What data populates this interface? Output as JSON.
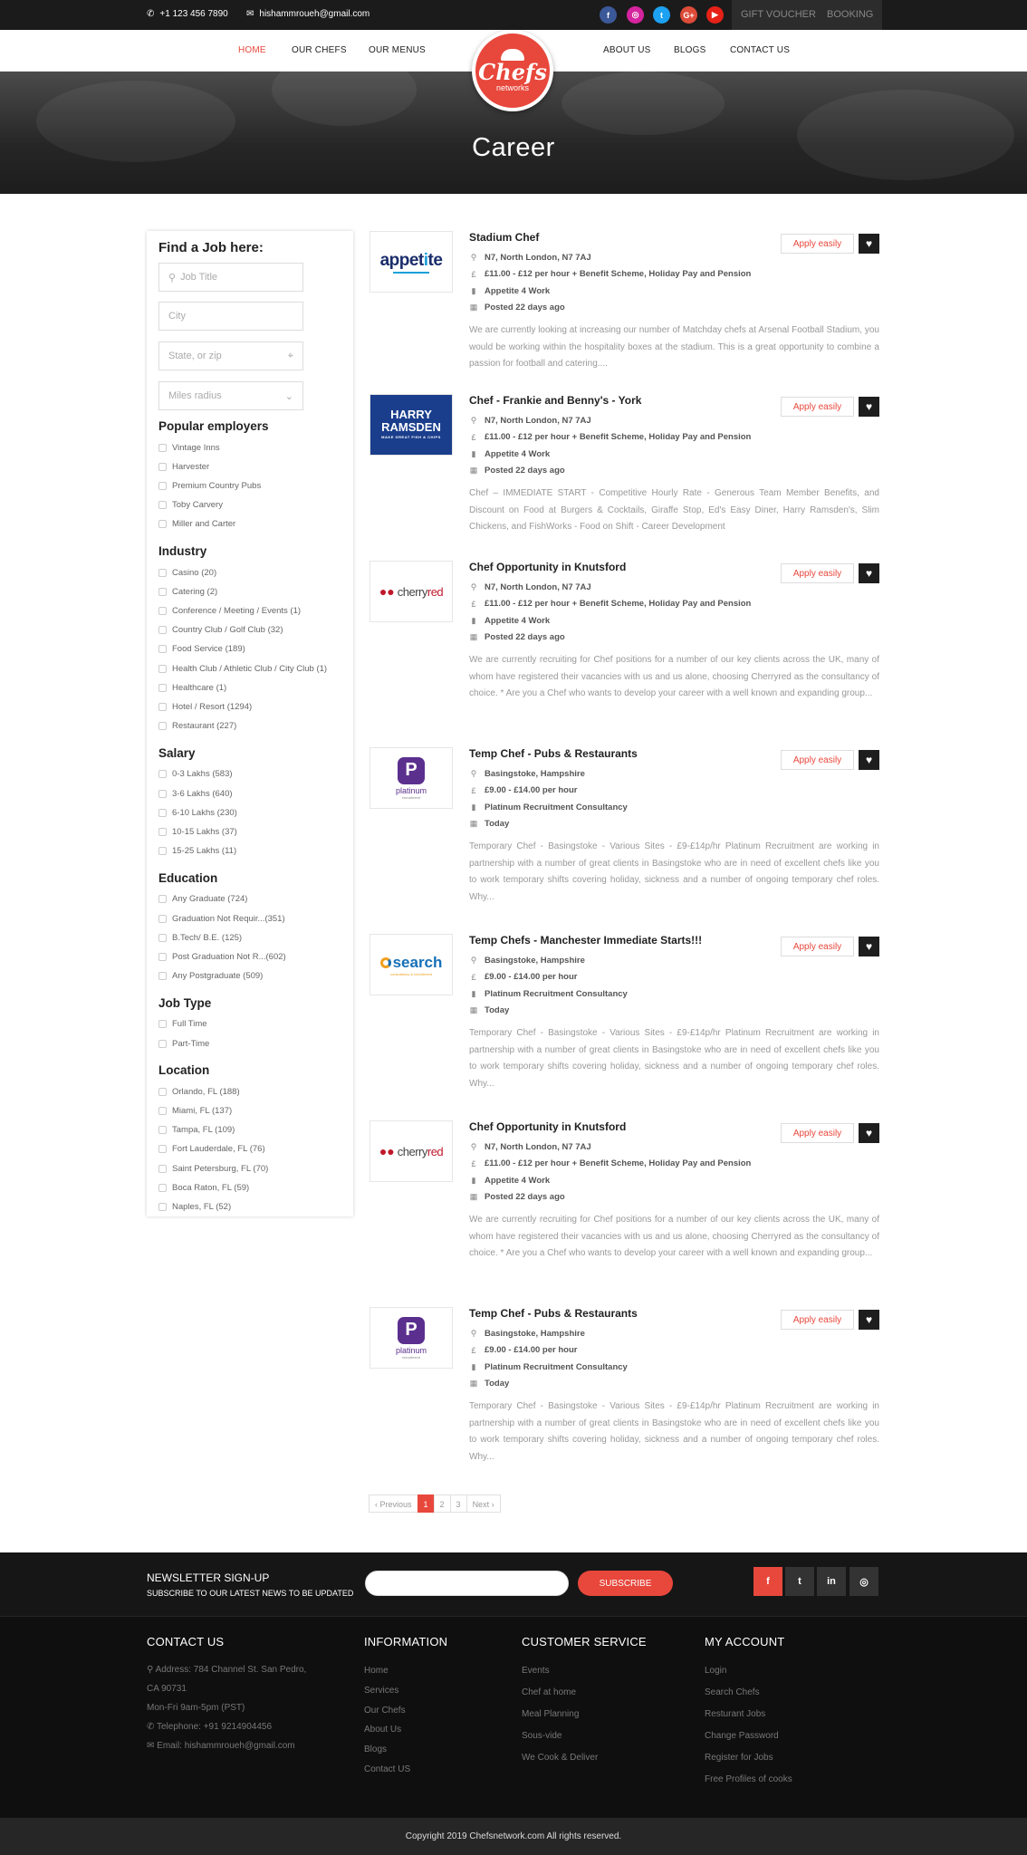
{
  "topbar": {
    "phone": "+1 123 456 7890",
    "email": "hishammroueh@gmail.com",
    "social": [
      {
        "icon": "facebook-icon",
        "glyph": "f",
        "color": "#3b5998"
      },
      {
        "icon": "instagram-icon",
        "glyph": "◎",
        "color": "#d6249f"
      },
      {
        "icon": "twitter-icon",
        "glyph": "t",
        "color": "#1da1f2"
      },
      {
        "icon": "google-plus-icon",
        "glyph": "G+",
        "color": "#dd4b39"
      },
      {
        "icon": "youtube-icon",
        "glyph": "▶",
        "color": "#e62117"
      }
    ],
    "gift_voucher": "GIFT VOUCHER",
    "booking": "BOOKING"
  },
  "nav": {
    "home": "HOME",
    "our_chefs": "OUR CHEFS",
    "our_menus": "OUR MENUS",
    "about_us": "ABOUT US",
    "blogs": "BLOGS",
    "contact_us": "CONTACT US",
    "logo_line1": "Chefs",
    "logo_line2": "networks",
    "accent": "#e8473c"
  },
  "hero": {
    "title": "Career"
  },
  "filter": {
    "title": "Find a Job here:",
    "job_title_placeholder": "Job Title",
    "city_placeholder": "City",
    "state_placeholder": "State, or zip",
    "radius_placeholder": "Miles radius",
    "sections": [
      {
        "title": "Popular employers",
        "options": [
          "Vintage Inns",
          "Harvester",
          "Premium Country Pubs",
          "Toby Carvery",
          "Miller and Carter"
        ]
      },
      {
        "title": "Industry",
        "options": [
          "Casino (20)",
          "Catering (2)",
          "Conference / Meeting / Events (1)",
          "Country Club / Golf Club (32)",
          "Food Service (189)",
          "Health Club / Athletic Club / City Club (1)",
          "Healthcare (1)",
          "Hotel / Resort (1294)",
          "Restaurant (227)"
        ]
      },
      {
        "title": "Salary",
        "options": [
          "0-3 Lakhs (583)",
          "3-6 Lakhs (640)",
          "6-10 Lakhs (230)",
          "10-15 Lakhs (37)",
          "15-25 Lakhs (11)"
        ]
      },
      {
        "title": "Education",
        "options": [
          "Any Graduate (724)",
          "Graduation Not Requir...(351)",
          "B.Tech/ B.E. (125)",
          "Post Graduation Not R...(602)",
          "Any Postgraduate (509)"
        ]
      },
      {
        "title": "Job Type",
        "options": [
          "Full Time",
          "Part-Time"
        ]
      },
      {
        "title": "Location",
        "options": [
          "Orlando, FL (188)",
          "Miami, FL (137)",
          "Tampa, FL (109)",
          "Fort Lauderdale, FL (76)",
          "Saint Petersburg, FL (70)",
          "Boca Raton, FL (59)",
          "Naples, FL (52)"
        ]
      }
    ]
  },
  "jobs": [
    {
      "logo": "appetite",
      "logo_text": "appetite",
      "title": "Stadium Chef",
      "location": "N7, North London, N7 7AJ",
      "salary": "£11.00 - £12 per hour + Benefit Scheme, Holiday Pay and Pension",
      "company": "Appetite 4 Work",
      "posted": "Posted 22 days ago",
      "desc": "We are currently looking at increasing our number of Matchday chefs at Arsenal Football Stadium, you would be working within the hospitality boxes at the stadium. This is a great opportunity to combine a passion for football and catering....",
      "apply": "Apply easily"
    },
    {
      "logo": "harry",
      "logo_text": "HARRY RAMSDEN",
      "title": "Chef - Frankie and Benny's - York",
      "location": "N7, North London, N7 7AJ",
      "salary": "£11.00 - £12 per hour + Benefit Scheme, Holiday Pay and Pension",
      "company": "Appetite 4 Work",
      "posted": "Posted 22 days ago",
      "desc": "Chef – IMMEDIATE START - Competitive Hourly Rate - Generous Team Member Benefits, and Discount on Food at Burgers & Cocktails, Giraffe Stop, Ed's Easy Diner, Harry Ramsden's, Slim Chickens, and FishWorks - Food on Shift - Career Development",
      "apply": "Apply easily"
    },
    {
      "logo": "cherry",
      "logo_text": "cherryred",
      "title": "Chef Opportunity in Knutsford",
      "location": "N7, North London, N7 7AJ",
      "salary": "£11.00 - £12 per hour + Benefit Scheme, Holiday Pay and Pension",
      "company": "Appetite 4 Work",
      "posted": "Posted 22 days ago",
      "desc": "We are currently recruiting for Chef positions for a number of our key clients across the UK, many of whom have registered their vacancies with us and us alone, choosing Cherryred as the consultancy of choice. * Are you a Chef who wants to develop your career with a well known and expanding group...",
      "apply": "Apply easily"
    },
    {
      "logo": "platinum",
      "logo_text": "platinum",
      "title": "Temp Chef - Pubs & Restaurants",
      "location": "Basingstoke, Hampshire",
      "salary": "£9.00 - £14.00 per hour",
      "company": "Platinum Recruitment Consultancy",
      "posted": "Today",
      "desc": "Temporary Chef - Basingstoke - Various Sites - £9-£14p/hr Platinum Recruitment are working in partnership with a number of great clients in Basingstoke who are in need of excellent chefs like you to work temporary shifts covering holiday, sickness and a number of ongoing temporary chef roles. Why...",
      "apply": "Apply easily"
    },
    {
      "logo": "search",
      "logo_text": "search",
      "title": "Temp Chefs - Manchester Immediate Starts!!!",
      "location": "Basingstoke, Hampshire",
      "salary": "£9.00 - £14.00 per hour",
      "company": "Platinum Recruitment Consultancy",
      "posted": "Today",
      "desc": "Temporary Chef - Basingstoke - Various Sites - £9-£14p/hr Platinum Recruitment are working in partnership with a number of great clients in Basingstoke who are in need of excellent chefs like you to work temporary shifts covering holiday, sickness and a number of ongoing temporary chef roles. Why...",
      "apply": "Apply easily"
    },
    {
      "logo": "cherry",
      "logo_text": "cherryred",
      "title": "Chef Opportunity in Knutsford",
      "location": "N7, North London, N7 7AJ",
      "salary": "£11.00 - £12 per hour + Benefit Scheme, Holiday Pay and Pension",
      "company": "Appetite 4 Work",
      "posted": "Posted 22 days ago",
      "desc": "We are currently recruiting for Chef positions for a number of our key clients across the UK, many of whom have registered their vacancies with us and us alone, choosing Cherryred as the consultancy of choice. * Are you a Chef who wants to develop your career with a well known and expanding group...",
      "apply": "Apply easily"
    },
    {
      "logo": "platinum",
      "logo_text": "platinum",
      "title": "Temp Chef - Pubs & Restaurants",
      "location": "Basingstoke, Hampshire",
      "salary": "£9.00 - £14.00 per hour",
      "company": "Platinum Recruitment Consultancy",
      "posted": "Today",
      "desc": "Temporary Chef - Basingstoke - Various Sites - £9-£14p/hr Platinum Recruitment are working in partnership with a number of great clients in Basingstoke who are in need of excellent chefs like you to work temporary shifts covering holiday, sickness and a number of ongoing temporary chef roles. Why...",
      "apply": "Apply easily"
    }
  ],
  "pagination": {
    "prev": "‹ Previous",
    "pages": [
      "1",
      "2",
      "3"
    ],
    "current": "1",
    "next": "Next ›"
  },
  "newsletter": {
    "title": "NEWSLETTER SIGN-UP",
    "subtitle": "SUBSCRIBE TO OUR LATEST NEWS TO BE UPDATED",
    "input_value": "",
    "button": "SUBSCRIBE",
    "social": [
      {
        "icon": "facebook-icon",
        "glyph": "f",
        "color": "#e8473c"
      },
      {
        "icon": "twitter-icon",
        "glyph": "t",
        "color": "#333333"
      },
      {
        "icon": "linkedin-icon",
        "glyph": "in",
        "color": "#333333"
      },
      {
        "icon": "instagram-icon",
        "glyph": "◎",
        "color": "#333333"
      }
    ]
  },
  "footer": {
    "contact": {
      "title": "CONTACT US",
      "address": "Address: 784 Channel St. San Pedro,",
      "address2": "CA 90731",
      "hours": "Mon-Fri 9am-5pm (PST)",
      "telephone": "Telephone: +91 9214904456",
      "email": "Email: hishammroueh@gmail.com"
    },
    "information": {
      "title": "INFORMATION",
      "links": [
        "Home",
        "Services",
        "Our Chefs",
        "About Us",
        "Blogs",
        "Contact US"
      ]
    },
    "customer_service": {
      "title": "CUSTOMER SERVICE",
      "links": [
        "Events",
        "Chef at home",
        "Meal Planning",
        "Sous-vide",
        "We Cook & Deliver"
      ]
    },
    "my_account": {
      "title": "MY ACCOUNT",
      "links": [
        "Login",
        "Search Chefs",
        "Resturant Jobs",
        "Change Password",
        "Register for Jobs",
        "Free Profiles of cooks"
      ]
    },
    "copyright": "Copyright 2019 Chefsnetwork.com All rights reserved."
  }
}
